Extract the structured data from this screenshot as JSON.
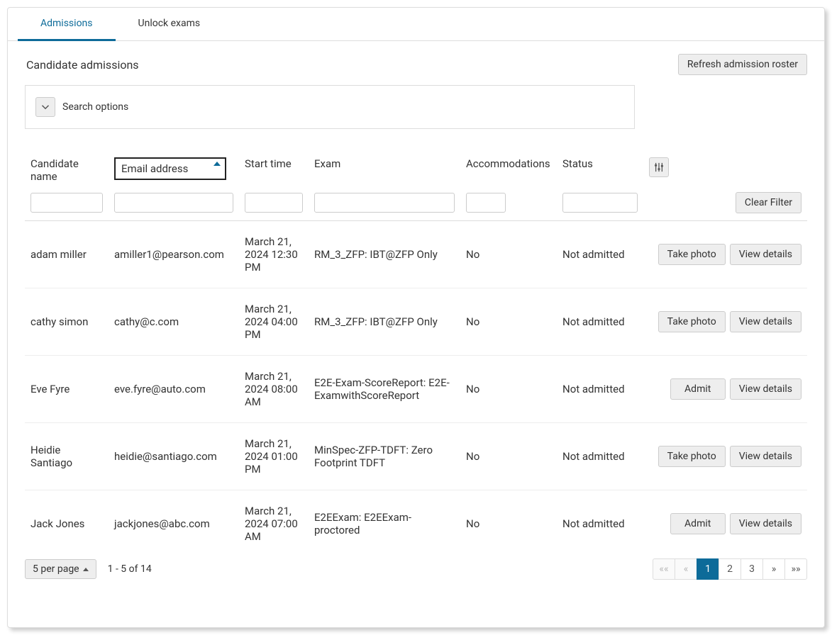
{
  "tabs": [
    {
      "label": "Admissions",
      "active": true
    },
    {
      "label": "Unlock exams",
      "active": false
    }
  ],
  "section_title": "Candidate admissions",
  "refresh_label": "Refresh admission roster",
  "search_options_label": "Search options",
  "columns": {
    "name": "Candidate name",
    "email": "Email address",
    "start": "Start time",
    "exam": "Exam",
    "accom": "Accommodations",
    "status": "Status"
  },
  "sorted_column": "email",
  "sort_direction": "asc",
  "clear_filter_label": "Clear Filter",
  "filters": {
    "name": "",
    "email": "",
    "start": "",
    "exam": "",
    "accom": "",
    "status": ""
  },
  "rows": [
    {
      "name": "adam miller",
      "email": "amiller1@pearson.com",
      "start": "March 21, 2024 12:30 PM",
      "exam": "RM_3_ZFP: IBT@ZFP Only",
      "accom": "No",
      "status": "Not admitted",
      "primary_action": "Take photo"
    },
    {
      "name": "cathy simon",
      "email": "cathy@c.com",
      "start": "March 21, 2024 04:00 PM",
      "exam": "RM_3_ZFP: IBT@ZFP Only",
      "accom": "No",
      "status": "Not admitted",
      "primary_action": "Take photo"
    },
    {
      "name": "Eve Fyre",
      "email": "eve.fyre@auto.com",
      "start": "March 21, 2024 08:00 AM",
      "exam": "E2E-Exam-ScoreReport: E2E-ExamwithScoreReport",
      "accom": "No",
      "status": "Not admitted",
      "primary_action": "Admit"
    },
    {
      "name": "Heidie Santiago",
      "email": "heidie@santiago.com",
      "start": "March 21, 2024 01:00 PM",
      "exam": "MinSpec-ZFP-TDFT: Zero Footprint TDFT",
      "accom": "No",
      "status": "Not admitted",
      "primary_action": "Take photo"
    },
    {
      "name": "Jack Jones",
      "email": "jackjones@abc.com",
      "start": "March 21, 2024 07:00 AM",
      "exam": "E2EExam: E2EExam-proctored",
      "accom": "No",
      "status": "Not admitted",
      "primary_action": "Admit"
    }
  ],
  "view_details_label": "View details",
  "pagination": {
    "per_page_label": "5 per page",
    "range_label": "1 - 5 of 14",
    "first": "««",
    "prev": "«",
    "pages": [
      "1",
      "2",
      "3"
    ],
    "current_page": "1",
    "next": "»",
    "last": "»»"
  }
}
